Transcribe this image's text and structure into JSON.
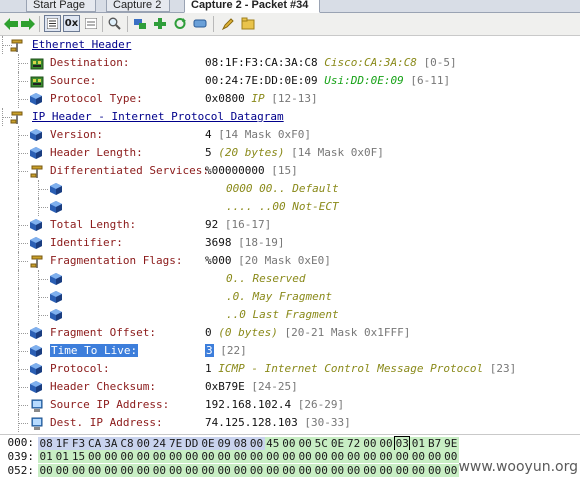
{
  "tabs": [
    {
      "label": "Start Page"
    },
    {
      "label": "Capture 2"
    },
    {
      "label": "Capture 2 - Packet #34"
    }
  ],
  "toolbar": {
    "hex_label": "0x"
  },
  "tree": [
    {
      "kind": "header",
      "label": "Ethernet Header",
      "icon": "protocol-icon"
    },
    {
      "kind": "field",
      "label": "Destination:",
      "value": "08:1F:F3:CA:3A:C8",
      "note": "Cisco:CA:3A:C8",
      "offset": "[0-5]",
      "icon": "network-card-icon"
    },
    {
      "kind": "field",
      "label": "Source:",
      "value": "00:24:7E:DD:0E:09",
      "note": "Usi:DD:0E:09",
      "offset": "[6-11]",
      "icon": "network-card-icon"
    },
    {
      "kind": "field",
      "label": "Protocol Type:",
      "value": "0x0800",
      "note": "IP",
      "offset": "[12-13]",
      "icon": "field-cube-icon"
    },
    {
      "kind": "header",
      "label": "IP Header - Internet Protocol Datagram",
      "icon": "protocol-icon"
    },
    {
      "kind": "field",
      "label": "Version:",
      "value": "4",
      "offset": "[14 Mask 0xF0]",
      "icon": "field-cube-icon"
    },
    {
      "kind": "field",
      "label": "Header Length:",
      "value": "5",
      "note": "(20 bytes)",
      "offset": "[14 Mask 0x0F]",
      "icon": "field-cube-icon"
    },
    {
      "kind": "group",
      "label": "Differentiated Services:",
      "value": "%00000000",
      "offset": "[15]",
      "icon": "protocol-icon"
    },
    {
      "kind": "bit",
      "note": "0000 00.. Default"
    },
    {
      "kind": "bit",
      "note": ".... ..00 Not-ECT"
    },
    {
      "kind": "field",
      "label": "Total Length:",
      "value": "92",
      "offset": "[16-17]",
      "icon": "field-cube-icon"
    },
    {
      "kind": "field",
      "label": "Identifier:",
      "value": "3698",
      "offset": "[18-19]",
      "icon": "field-cube-icon"
    },
    {
      "kind": "group",
      "label": "Fragmentation Flags:",
      "value": "%000",
      "offset": "[20 Mask 0xE0]",
      "icon": "protocol-icon"
    },
    {
      "kind": "bit",
      "note": "0.. Reserved"
    },
    {
      "kind": "bit",
      "note": ".0. May Fragment"
    },
    {
      "kind": "bit",
      "note": "..0 Last Fragment"
    },
    {
      "kind": "field",
      "label": "Fragment Offset:",
      "value": "0",
      "note": "(0 bytes)",
      "offset": "[20-21 Mask 0x1FFF]",
      "icon": "field-cube-icon"
    },
    {
      "kind": "field",
      "label": "Time To Live:",
      "value": "3",
      "offset": "[22]",
      "icon": "field-cube-icon",
      "selected": true
    },
    {
      "kind": "field",
      "label": "Protocol:",
      "value": "1",
      "note": "ICMP - Internet Control Message Protocol",
      "offset": "[23]",
      "icon": "field-cube-icon"
    },
    {
      "kind": "field",
      "label": "Header Checksum:",
      "value": "0xB79E",
      "offset": "[24-25]",
      "icon": "field-cube-icon"
    },
    {
      "kind": "field",
      "label": "Source IP Address:",
      "value": "192.168.102.4",
      "offset": "[26-29]",
      "icon": "computer-icon"
    },
    {
      "kind": "field",
      "label": "Dest. IP Address:",
      "value": "74.125.128.103",
      "offset": "[30-33]",
      "icon": "computer-icon"
    }
  ],
  "hex": [
    {
      "addr": "000:",
      "bytes": [
        "08",
        "1F",
        "F3",
        "CA",
        "3A",
        "C8",
        "00",
        "24",
        "7E",
        "DD",
        "0E",
        "09",
        "08",
        "00",
        "45",
        "00",
        "00",
        "5C",
        "0E",
        "72",
        "00",
        "00",
        "03",
        "01",
        "B7",
        "9E"
      ]
    },
    {
      "addr": "039:",
      "bytes": [
        "01",
        "01",
        "15",
        "00",
        "00",
        "00",
        "00",
        "00",
        "00",
        "00",
        "00",
        "00",
        "00",
        "00",
        "00",
        "00",
        "00",
        "00",
        "00",
        "00",
        "00",
        "00",
        "00",
        "00",
        "00",
        "00"
      ]
    },
    {
      "addr": "052:",
      "bytes": [
        "00",
        "00",
        "00",
        "00",
        "00",
        "00",
        "00",
        "00",
        "00",
        "00",
        "00",
        "00",
        "00",
        "00",
        "00",
        "00",
        "00",
        "00",
        "00",
        "00",
        "00",
        "00",
        "00",
        "00",
        "00",
        "00"
      ]
    }
  ],
  "watermark": "www.wooyun.org"
}
